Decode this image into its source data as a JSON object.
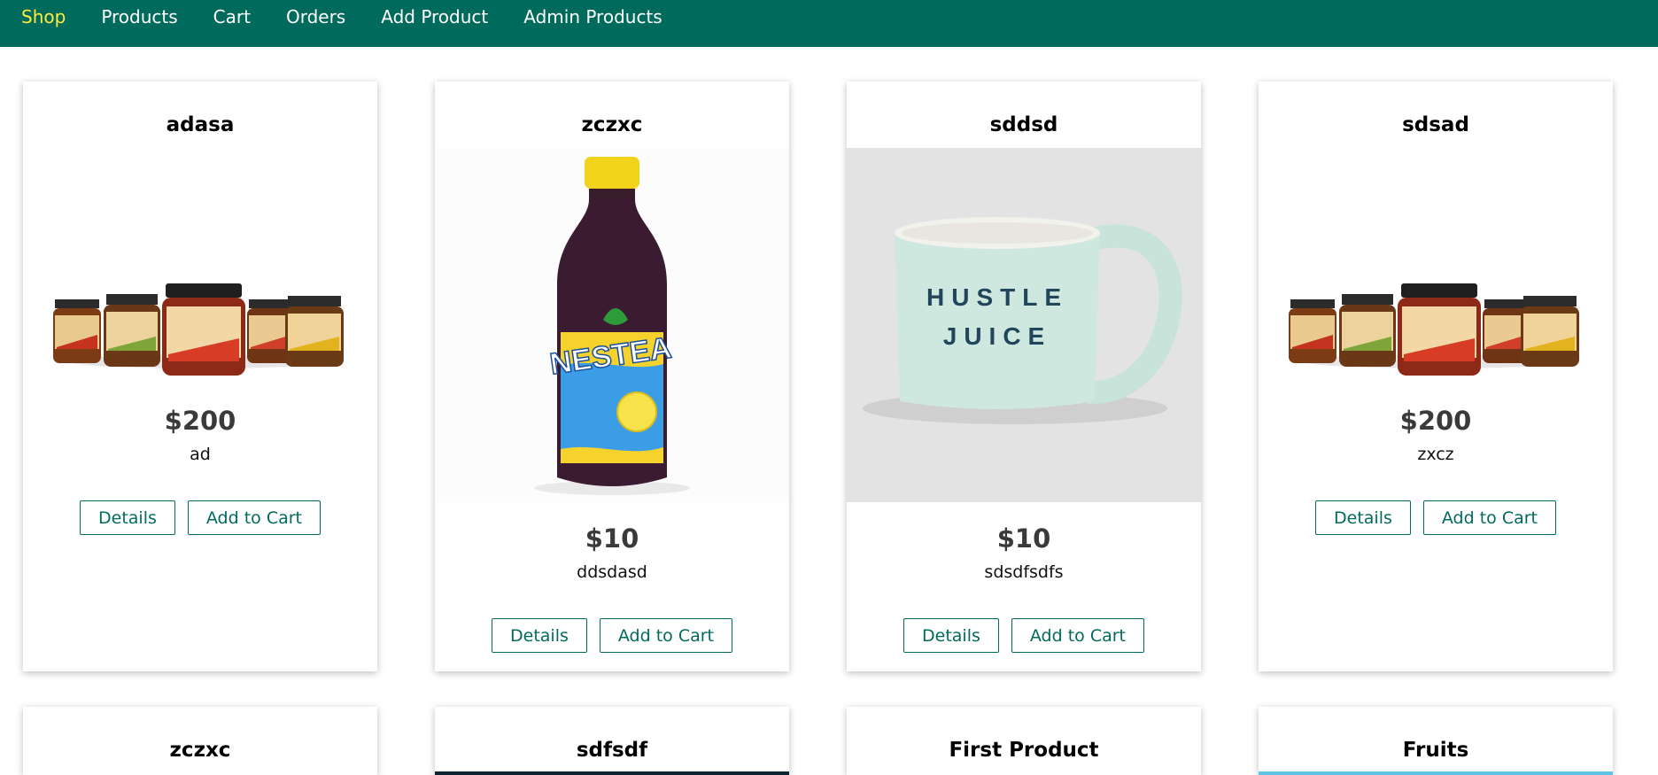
{
  "nav": {
    "items": [
      {
        "label": "Shop",
        "active": true
      },
      {
        "label": "Products",
        "active": false
      },
      {
        "label": "Cart",
        "active": false
      },
      {
        "label": "Orders",
        "active": false
      },
      {
        "label": "Add Product",
        "active": false
      },
      {
        "label": "Admin Products",
        "active": false
      }
    ]
  },
  "colors": {
    "header_bg": "#006b5c",
    "active_nav": "#ffeb3b",
    "button_accent": "#006b5c"
  },
  "products": [
    {
      "title": "adasa",
      "price": "$200",
      "description": "ad",
      "image": "jam-jars-image",
      "details_label": "Details",
      "add_to_cart_label": "Add to Cart"
    },
    {
      "title": "zczxc",
      "price": "$10",
      "description": "ddsdasd",
      "image": "iced-tea-bottle-image",
      "details_label": "Details",
      "add_to_cart_label": "Add to Cart"
    },
    {
      "title": "sddsd",
      "price": "$10",
      "description": "sdsdfsdfs",
      "image": "mug-image",
      "image_text_1": "HUSTLE",
      "image_text_2": "JUICE",
      "details_label": "Details",
      "add_to_cart_label": "Add to Cart"
    },
    {
      "title": "sdsad",
      "price": "$200",
      "description": "zxcz",
      "image": "jam-jars-image",
      "details_label": "Details",
      "add_to_cart_label": "Add to Cart"
    }
  ],
  "next_row_titles": [
    "zczxc",
    "sdfsdf",
    "First Product",
    "Fruits"
  ]
}
